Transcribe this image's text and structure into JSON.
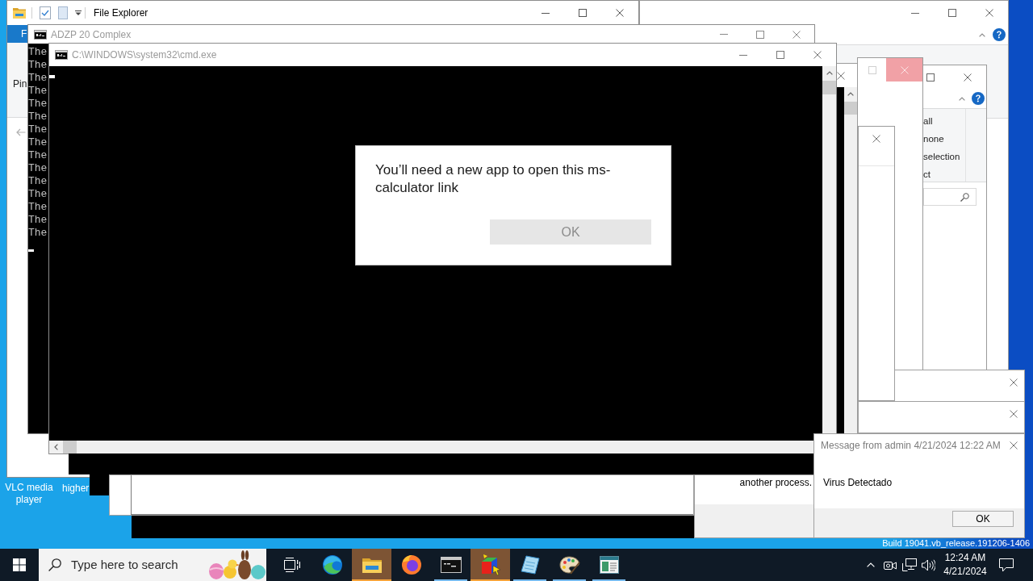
{
  "explorer_window": {
    "title": "File Explorer",
    "ribbon_tab": "F",
    "pane_label": "Pin"
  },
  "select_window": {
    "ribbon_items": [
      "all",
      "none",
      "selection",
      "ct"
    ]
  },
  "blank_window": {
    "close_highlighted": true
  },
  "adzp_window": {
    "title": "ADZP 20 Complex",
    "lines": [
      "The",
      "The",
      "The",
      "The",
      "The",
      "The",
      "The",
      "The",
      "The",
      "The",
      "The",
      "The",
      "The",
      "The",
      "The"
    ]
  },
  "cmd_window": {
    "title": "C:\\WINDOWS\\system32\\cmd.exe"
  },
  "app_dialog": {
    "message": "You’ll need a new app to open this ms-calculator link",
    "button": {
      "label": "OK",
      "disabled": true
    }
  },
  "message_box": {
    "title": "Message from admin 4/21/2024 12:22 AM",
    "message": "Virus Detectado",
    "button": "OK"
  },
  "process_window": {
    "text": "another process."
  },
  "desktop_icons": [
    {
      "label": "VLC media player"
    },
    {
      "label": "higher"
    }
  ],
  "build_info": "Build 19041.vb_release.191206-1406",
  "taskbar": {
    "search": {
      "placeholder": "Type here to search"
    },
    "apps": [
      {
        "kind": "wave-logo",
        "running": false,
        "flashing": false
      },
      {
        "kind": "folder",
        "running": true,
        "flashing": true
      },
      {
        "kind": "flame-logo",
        "running": false,
        "flashing": false
      },
      {
        "kind": "terminal",
        "running": true,
        "flashing": false
      },
      {
        "kind": "cube",
        "running": true,
        "flashing": true
      },
      {
        "kind": "notepad",
        "running": true,
        "flashing": false
      },
      {
        "kind": "palette",
        "running": true,
        "flashing": false
      },
      {
        "kind": "window",
        "running": true,
        "flashing": false
      }
    ],
    "clock": {
      "time": "12:24 AM",
      "date": "4/21/2024"
    }
  }
}
